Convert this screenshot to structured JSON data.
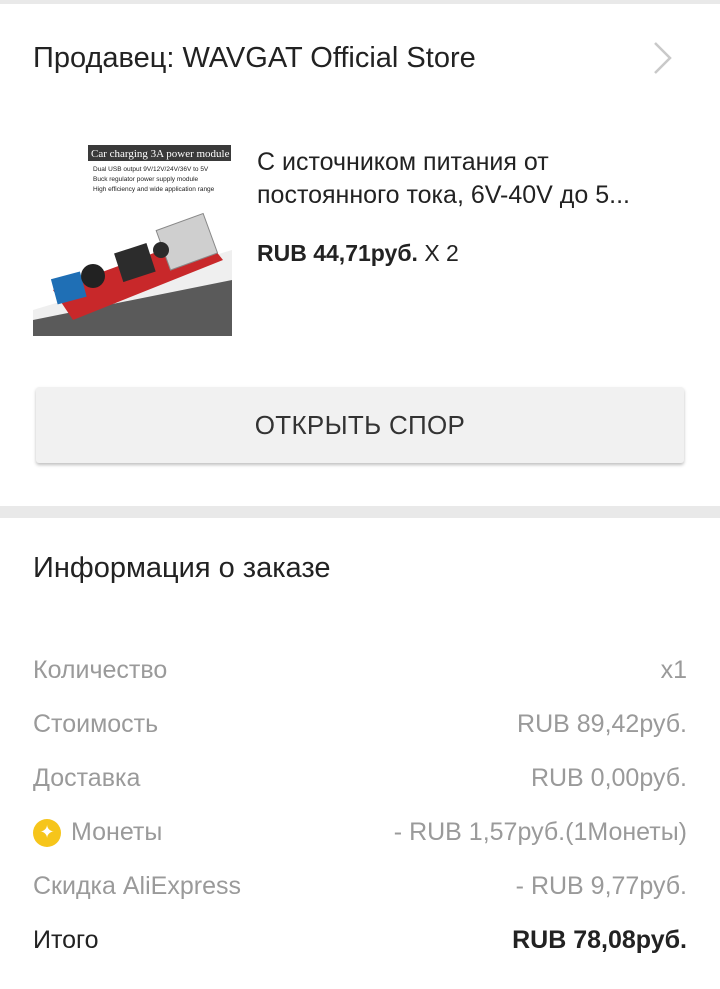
{
  "seller": {
    "label": "Продавец: WAVGAT Official Store"
  },
  "product": {
    "image_caption_title": "Car charging 3A power module",
    "image_caption_lines": [
      "Dual USB output 9V/12V/24V/36V to 5V",
      "Buck regulator power supply module",
      "High efficiency and wide application range"
    ],
    "title_line1": "С источником питания от",
    "title_line2": "постоянного тока, 6V-40V до 5...",
    "price": "RUB 44,71руб.",
    "quantity": "X 2"
  },
  "dispute_button": {
    "label": "ОТКРЫТЬ СПОР"
  },
  "order_info": {
    "title": "Информация о заказе",
    "rows": [
      {
        "label": "Количество",
        "value": "x1"
      },
      {
        "label": "Стоимость",
        "value": "RUB 89,42руб."
      },
      {
        "label": "Доставка",
        "value": "RUB 0,00руб."
      },
      {
        "label": "Монеты",
        "value": "- RUB 1,57руб.(1Монеты)"
      },
      {
        "label": "Скидка AliExpress",
        "value": "- RUB 9,77руб."
      },
      {
        "label": "Итого",
        "value": "RUB 78,08руб."
      }
    ]
  },
  "colors": {
    "background": "#e9e9e9",
    "card": "#ffffff",
    "coin": "#f6c51b",
    "muted_text": "#9a9a9a"
  },
  "icons": {
    "chevron": "chevron-right-icon",
    "coin": "coin-icon"
  }
}
